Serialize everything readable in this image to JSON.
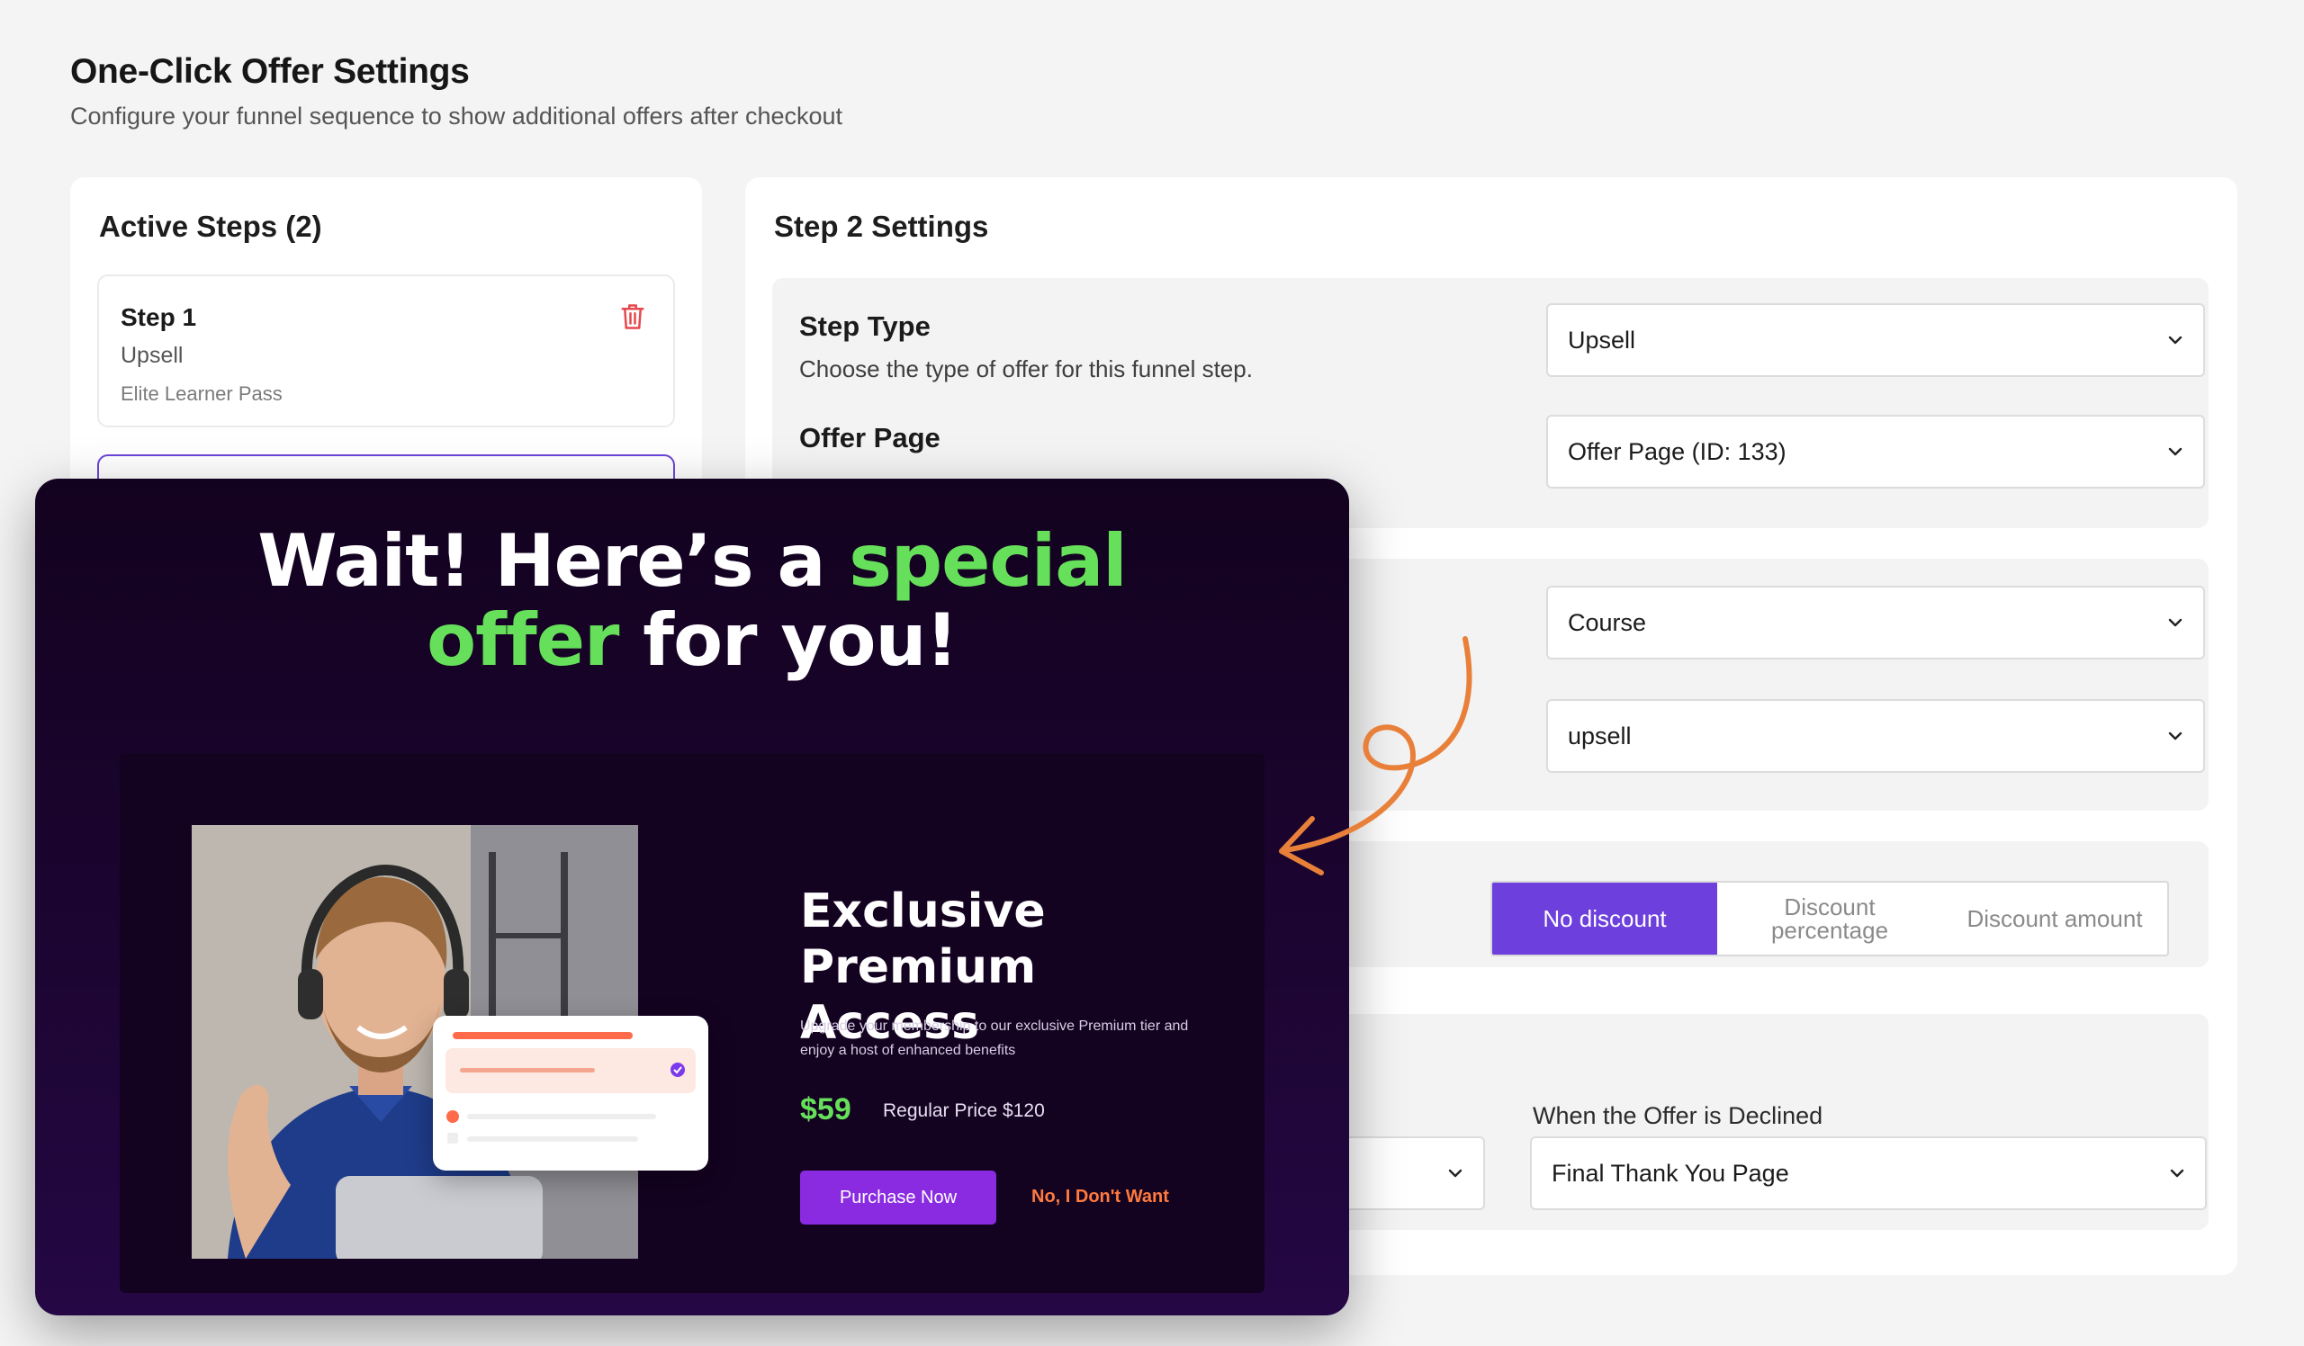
{
  "header": {
    "title": "One-Click Offer Settings",
    "subtitle": "Configure your funnel sequence to show additional offers after checkout"
  },
  "steps": {
    "title": "Active Steps (2)",
    "items": [
      {
        "name": "Step 1",
        "type": "Upsell",
        "product": "Elite Learner Pass"
      }
    ]
  },
  "settings": {
    "title": "Step 2 Settings",
    "step_type": {
      "label": "Step Type",
      "description": "Choose the type of offer for this funnel step.",
      "value": "Upsell"
    },
    "offer_page": {
      "label": "Offer Page",
      "value": "Offer Page (ID: 133)"
    },
    "product_type": {
      "value": "Course"
    },
    "product": {
      "value": "upsell"
    },
    "discount": {
      "options": [
        "No discount",
        "Discount percentage",
        "Discount amount"
      ],
      "selected": "No discount"
    },
    "declined": {
      "label": "When the Offer is Declined",
      "value": "Final Thank You Page"
    }
  },
  "promo": {
    "headline_part1": "Wait! Here’s a ",
    "headline_hl1": "special",
    "headline_hl2": "offer",
    "headline_part2": " for you!",
    "product_title": "Exclusive Premium Access",
    "description": "Upgrade your membership to our exclusive Premium tier and enjoy a host of enhanced benefits",
    "price": "$59",
    "regular_price": "Regular Price $120",
    "purchase_label": "Purchase Now",
    "decline_label": "No, I Don't Want"
  },
  "colors": {
    "accent": "#6d3fdc",
    "promo_bg": "#1d0533",
    "highlight": "#66e05b",
    "decline": "#ff7a3d",
    "purchase": "#8a2be2",
    "arrow": "#e8803a"
  }
}
